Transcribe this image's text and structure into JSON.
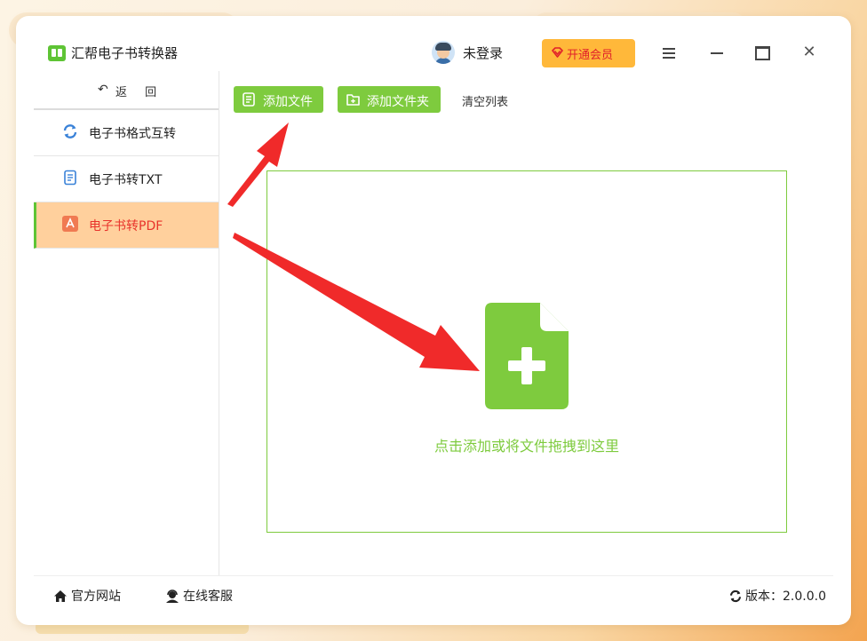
{
  "app": {
    "title": "汇帮电子书转换器",
    "user": "未登录",
    "vip_label": "开通会员"
  },
  "sidebar": {
    "back_label": "返 回",
    "items": [
      {
        "label": "电子书格式互转",
        "icon": "sync-icon"
      },
      {
        "label": "电子书转TXT",
        "icon": "document-icon"
      },
      {
        "label": "电子书转PDF",
        "icon": "pdf-icon",
        "active": true
      }
    ]
  },
  "toolbar": {
    "add_file": "添加文件",
    "add_folder": "添加文件夹",
    "clear_list": "清空列表"
  },
  "dropzone": {
    "hint": "点击添加或将文件拖拽到这里"
  },
  "footer": {
    "website": "官方网站",
    "support": "在线客服",
    "version": "版本：2.0.0.0"
  },
  "colors": {
    "accent_green": "#7ecb3e",
    "active_bg": "#ffd09d",
    "vip": "#ffb83a",
    "arrow": "#f02a2a"
  }
}
